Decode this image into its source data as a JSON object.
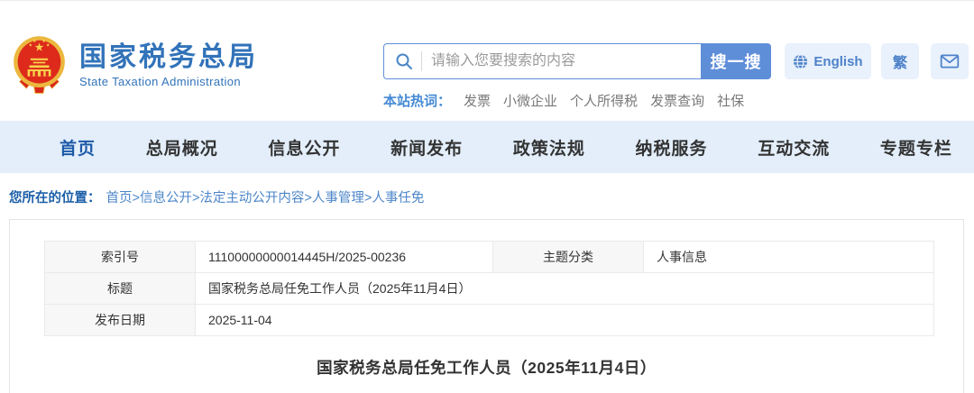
{
  "header": {
    "logo": {
      "title": "国家税务总局",
      "subtitle": "State Taxation Administration"
    },
    "search": {
      "placeholder": "请输入您要搜索的内容",
      "button_label": "搜一搜"
    },
    "hot_words": {
      "label": "本站热词：",
      "items": [
        "发票",
        "小微企业",
        "个人所得税",
        "发票查询",
        "社保"
      ]
    },
    "lang_english_label": "English",
    "lang_traditional_label": "繁"
  },
  "nav": {
    "items": [
      {
        "label": "首页",
        "active": true
      },
      {
        "label": "总局概况",
        "active": false
      },
      {
        "label": "信息公开",
        "active": false
      },
      {
        "label": "新闻发布",
        "active": false
      },
      {
        "label": "政策法规",
        "active": false
      },
      {
        "label": "纳税服务",
        "active": false
      },
      {
        "label": "互动交流",
        "active": false
      },
      {
        "label": "专题专栏",
        "active": false
      }
    ]
  },
  "breadcrumb": {
    "label": "您所在的位置：",
    "path": "首页>信息公开>法定主动公开内容>人事管理>人事任免"
  },
  "meta_table": {
    "index_label": "索引号",
    "index_value": "11100000000014445H/2025-00236",
    "category_label": "主题分类",
    "category_value": "人事信息",
    "title_label": "标题",
    "title_value": "国家税务总局任免工作人员（2025年11月4日）",
    "date_label": "发布日期",
    "date_value": "2025-11-04"
  },
  "article": {
    "title": "国家税务总局任免工作人员（2025年11月4日）"
  },
  "colors": {
    "brand_blue": "#3273b9",
    "accent_blue": "#5f8ed9",
    "nav_bg": "#e3eefa",
    "nav_active": "#1e5aa8",
    "pill_bg": "#e9f1fc",
    "label_cell_bg": "#f7f7f7"
  }
}
